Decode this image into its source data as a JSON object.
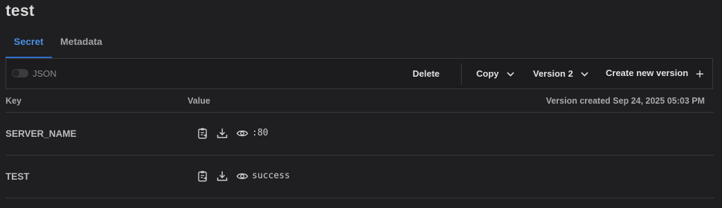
{
  "page": {
    "title": "test"
  },
  "tabs": [
    {
      "label": "Secret",
      "active": true
    },
    {
      "label": "Metadata",
      "active": false
    }
  ],
  "toolbar": {
    "json_label": "JSON",
    "json_toggle_on": false,
    "delete_label": "Delete",
    "copy_label": "Copy",
    "version_label": "Version 2",
    "create_label": "Create new version"
  },
  "table": {
    "key_header": "Key",
    "value_header": "Value",
    "version_created": "Version created Sep 24, 2025 05:03 PM",
    "rows": [
      {
        "key": "SERVER_NAME",
        "value": ":80"
      },
      {
        "key": "TEST",
        "value": "success"
      }
    ]
  },
  "icons": {
    "copy": "clipboard-icon",
    "download": "download-icon",
    "reveal": "eye-icon"
  },
  "colors": {
    "accent": "#4a90e2",
    "background": "#1f1f22"
  }
}
